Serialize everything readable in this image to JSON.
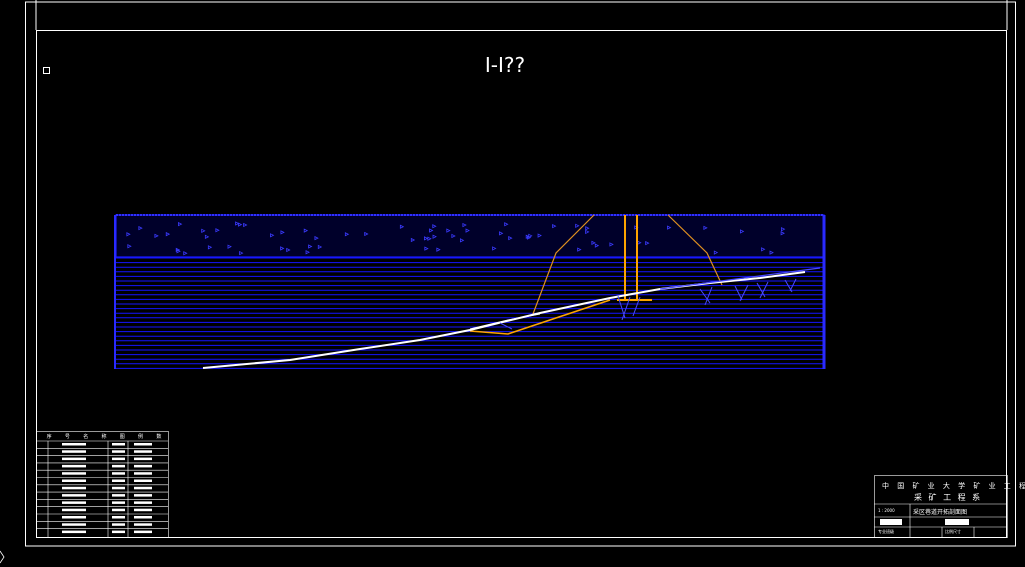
{
  "drawing": {
    "section_title": "I-I??",
    "frame_color": "#ffffff",
    "strata_color": "#0000ff",
    "seam_color": "#ffffff",
    "structure_color": "#ffa500"
  },
  "legend_table": {
    "header": [
      "序",
      "号",
      "名",
      "称",
      "",
      "图",
      "例",
      "",
      "数"
    ]
  },
  "title_block": {
    "school": "中 国 矿 业 大 学 矿 业 工 程",
    "department": "采 矿 工 程 系",
    "drawing_name": "采区巷道开拓剖面图",
    "scale_label": "1 : 2000",
    "bottom_left": "专业班级",
    "bottom_mid": "比例尺寸"
  }
}
